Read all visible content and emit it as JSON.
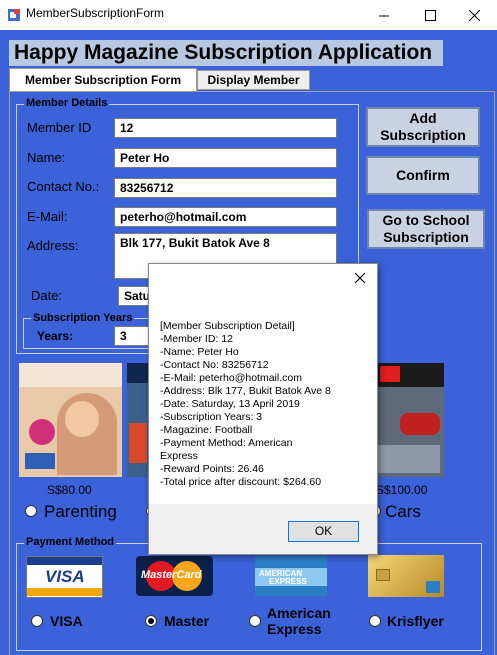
{
  "window": {
    "title": "MemberSubscriptionForm"
  },
  "banner": "Happy Magazine Subscription Application",
  "tabs": [
    {
      "label": "Member Subscription Form",
      "active": true
    },
    {
      "label": "Display Member",
      "active": false
    }
  ],
  "member_details": {
    "group_label": "Member Details",
    "member_id_label": "Member ID",
    "member_id_value": "12",
    "name_label": "Name:",
    "name_value": "Peter Ho",
    "contact_label": "Contact No.:",
    "contact_value": "83256712",
    "email_label": "E-Mail:",
    "email_value": "peterho@hotmail.com",
    "address_label": "Address:",
    "address_value": "Blk 177, Bukit Batok Ave 8",
    "date_label": "Date:",
    "date_value": "Satu",
    "subscription_years_label": "Subscription Years",
    "years_label": "Years:",
    "years_value": "3"
  },
  "buttons": {
    "add_line1": "Add",
    "add_line2": "Subscription",
    "confirm": "Confirm",
    "school_line1": "Go to School",
    "school_line2": "Subscription"
  },
  "magazines": [
    {
      "name": "Parenting",
      "price": "S$80.00",
      "selected": false
    },
    {
      "name": "Cars",
      "price": "S$100.00",
      "selected": false
    }
  ],
  "payment": {
    "group_label": "Payment Method",
    "options": [
      {
        "label": "VISA",
        "selected": false
      },
      {
        "label": "Master",
        "selected": true
      },
      {
        "label_line1": "American",
        "label_line2": "Express",
        "selected": false
      },
      {
        "label": "Krisflyer",
        "selected": false
      }
    ],
    "card_text": {
      "visa": "VISA",
      "master": "MasterCard",
      "amex_1": "AMERICAN",
      "amex_2": "EXPRESS"
    }
  },
  "dialog": {
    "lines": [
      "[Member Subscription Detail]",
      "-Member ID: 12",
      "-Name: Peter Ho",
      "-Contact No: 83256712",
      "-E-Mail: peterho@hotmail.com",
      "-Address: Blk 177, Bukit Batok Ave 8",
      "-Date: Saturday, 13 April 2019",
      "-Subscription Years: 3",
      "-Magazine: Football",
      "-Payment Method: American",
      "Express",
      "-Reward Points: 26.46",
      "-Total price after discount: $264.60"
    ],
    "ok": "OK"
  },
  "colors": {
    "form_bg": "#3b62d8",
    "button_bg": "#c9d2e0",
    "banner_bg": "#b8c8e0"
  }
}
